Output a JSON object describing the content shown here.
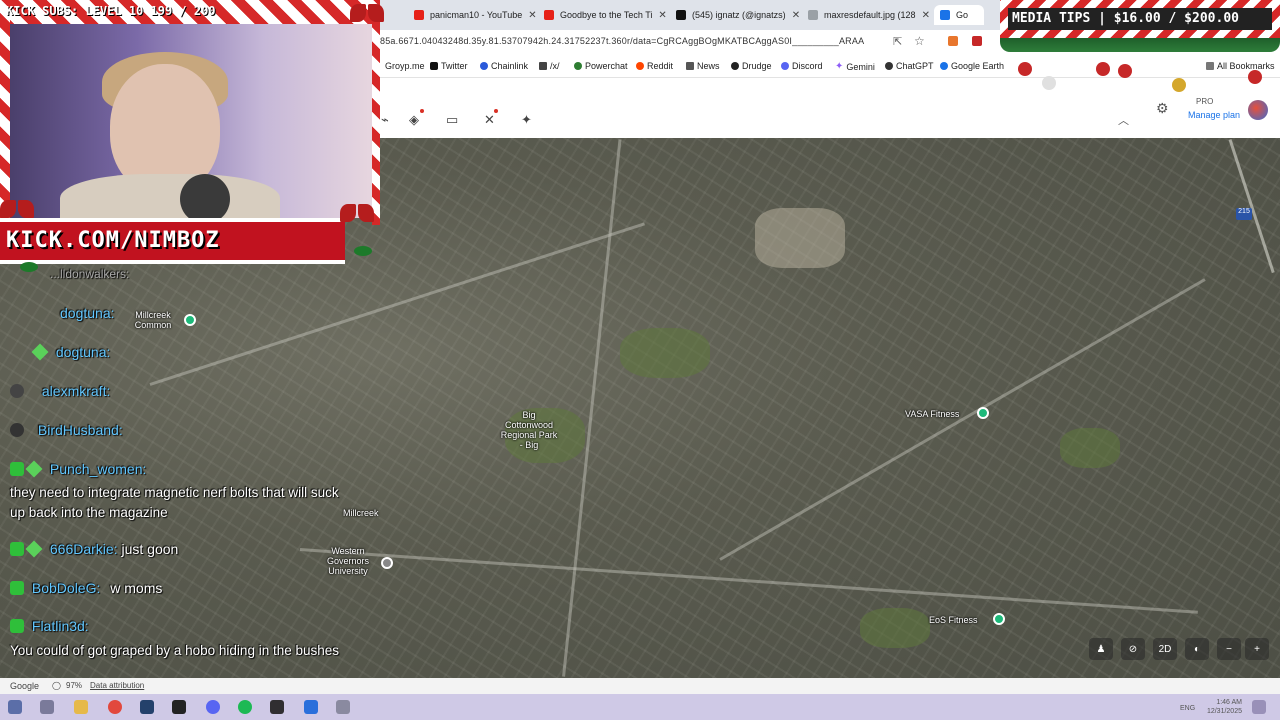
{
  "browser": {
    "tabs": [
      {
        "title": "panicman10 - YouTube",
        "color": "#e62117"
      },
      {
        "title": "Goodbye to the Tech Ti",
        "color": "#e62117"
      },
      {
        "title": "(545) ignatz (@ignatzs)",
        "color": "#111111"
      },
      {
        "title": "maxresdefault.jpg (128",
        "color": "#9aa0a6"
      },
      {
        "title": "Go",
        "color": "#1a73e8"
      }
    ],
    "url": "85a.6671.04043248d.35y.81.53707942h.24.31752237t.360r/data=CgRCAggBOgMKATBCAggAS0I_________ARAA",
    "bookmarks": [
      {
        "label": "Groyp.me",
        "color": "#ff8a00"
      },
      {
        "label": "Twitter",
        "color": "#111111"
      },
      {
        "label": "Chainlink",
        "color": "#2a5ada"
      },
      {
        "label": "/x/",
        "color": "#444444"
      },
      {
        "label": "Powerchat",
        "color": "#2e7d32"
      },
      {
        "label": "Reddit",
        "color": "#ff4500"
      },
      {
        "label": "News",
        "color": "#555555"
      },
      {
        "label": "Drudge",
        "color": "#222222"
      },
      {
        "label": "Discord",
        "color": "#5865f2"
      },
      {
        "label": "Gemini",
        "color": "#8e5cf7"
      },
      {
        "label": "ChatGPT",
        "color": "#333333"
      },
      {
        "label": "Google Earth",
        "color": "#1a73e8"
      }
    ],
    "all_bookmarks": "All Bookmarks"
  },
  "earth": {
    "pro_label": "PRO",
    "manage_plan": "Manage plan"
  },
  "map": {
    "labels": {
      "big_cottonwood": "Big Cottonwood Regional Park - Big",
      "vasa": "VASA Fitness",
      "millcreek": "Millcreek",
      "wgu": "Western Governors University",
      "eos": "EoS Fitness",
      "commons": "Millcreek Common",
      "route": "215"
    },
    "controls": {
      "view2d": "2D"
    }
  },
  "footer": {
    "google": "Google",
    "zoom": "97%",
    "attribution": "Data attribution"
  },
  "taskbar": {
    "lang": "ENG",
    "time": "1:46 AM",
    "date": "12/31/2025"
  },
  "stream": {
    "subs": "KICK SUBS: LEVEL 10 199 / 200",
    "kick_url": "KICK.COM/NIMBOZ",
    "tips": "MEDIA TIPS | $16.00 / $200.00"
  },
  "chat": {
    "lines": [
      {
        "user": "dogtuna:",
        "text": ""
      },
      {
        "user": "dogtuna:",
        "text": ""
      },
      {
        "user": "alexmkraft:",
        "text": ""
      },
      {
        "user": "BirdHusband:",
        "text": ""
      },
      {
        "user": "Punch_women:",
        "text": ""
      },
      {
        "user": "666Darkie:",
        "text": "just goon"
      },
      {
        "user": "BobDoleG:",
        "text": "w moms"
      },
      {
        "user": "Flatlin3d:",
        "text": ""
      }
    ],
    "msg_punch": "they need to integrate magnetic nerf bolts that will suck up back into the magazine",
    "msg_flatline": "You could of got graped by a hobo hiding in the bushes",
    "top_cut": "...lldonwalkers:"
  }
}
